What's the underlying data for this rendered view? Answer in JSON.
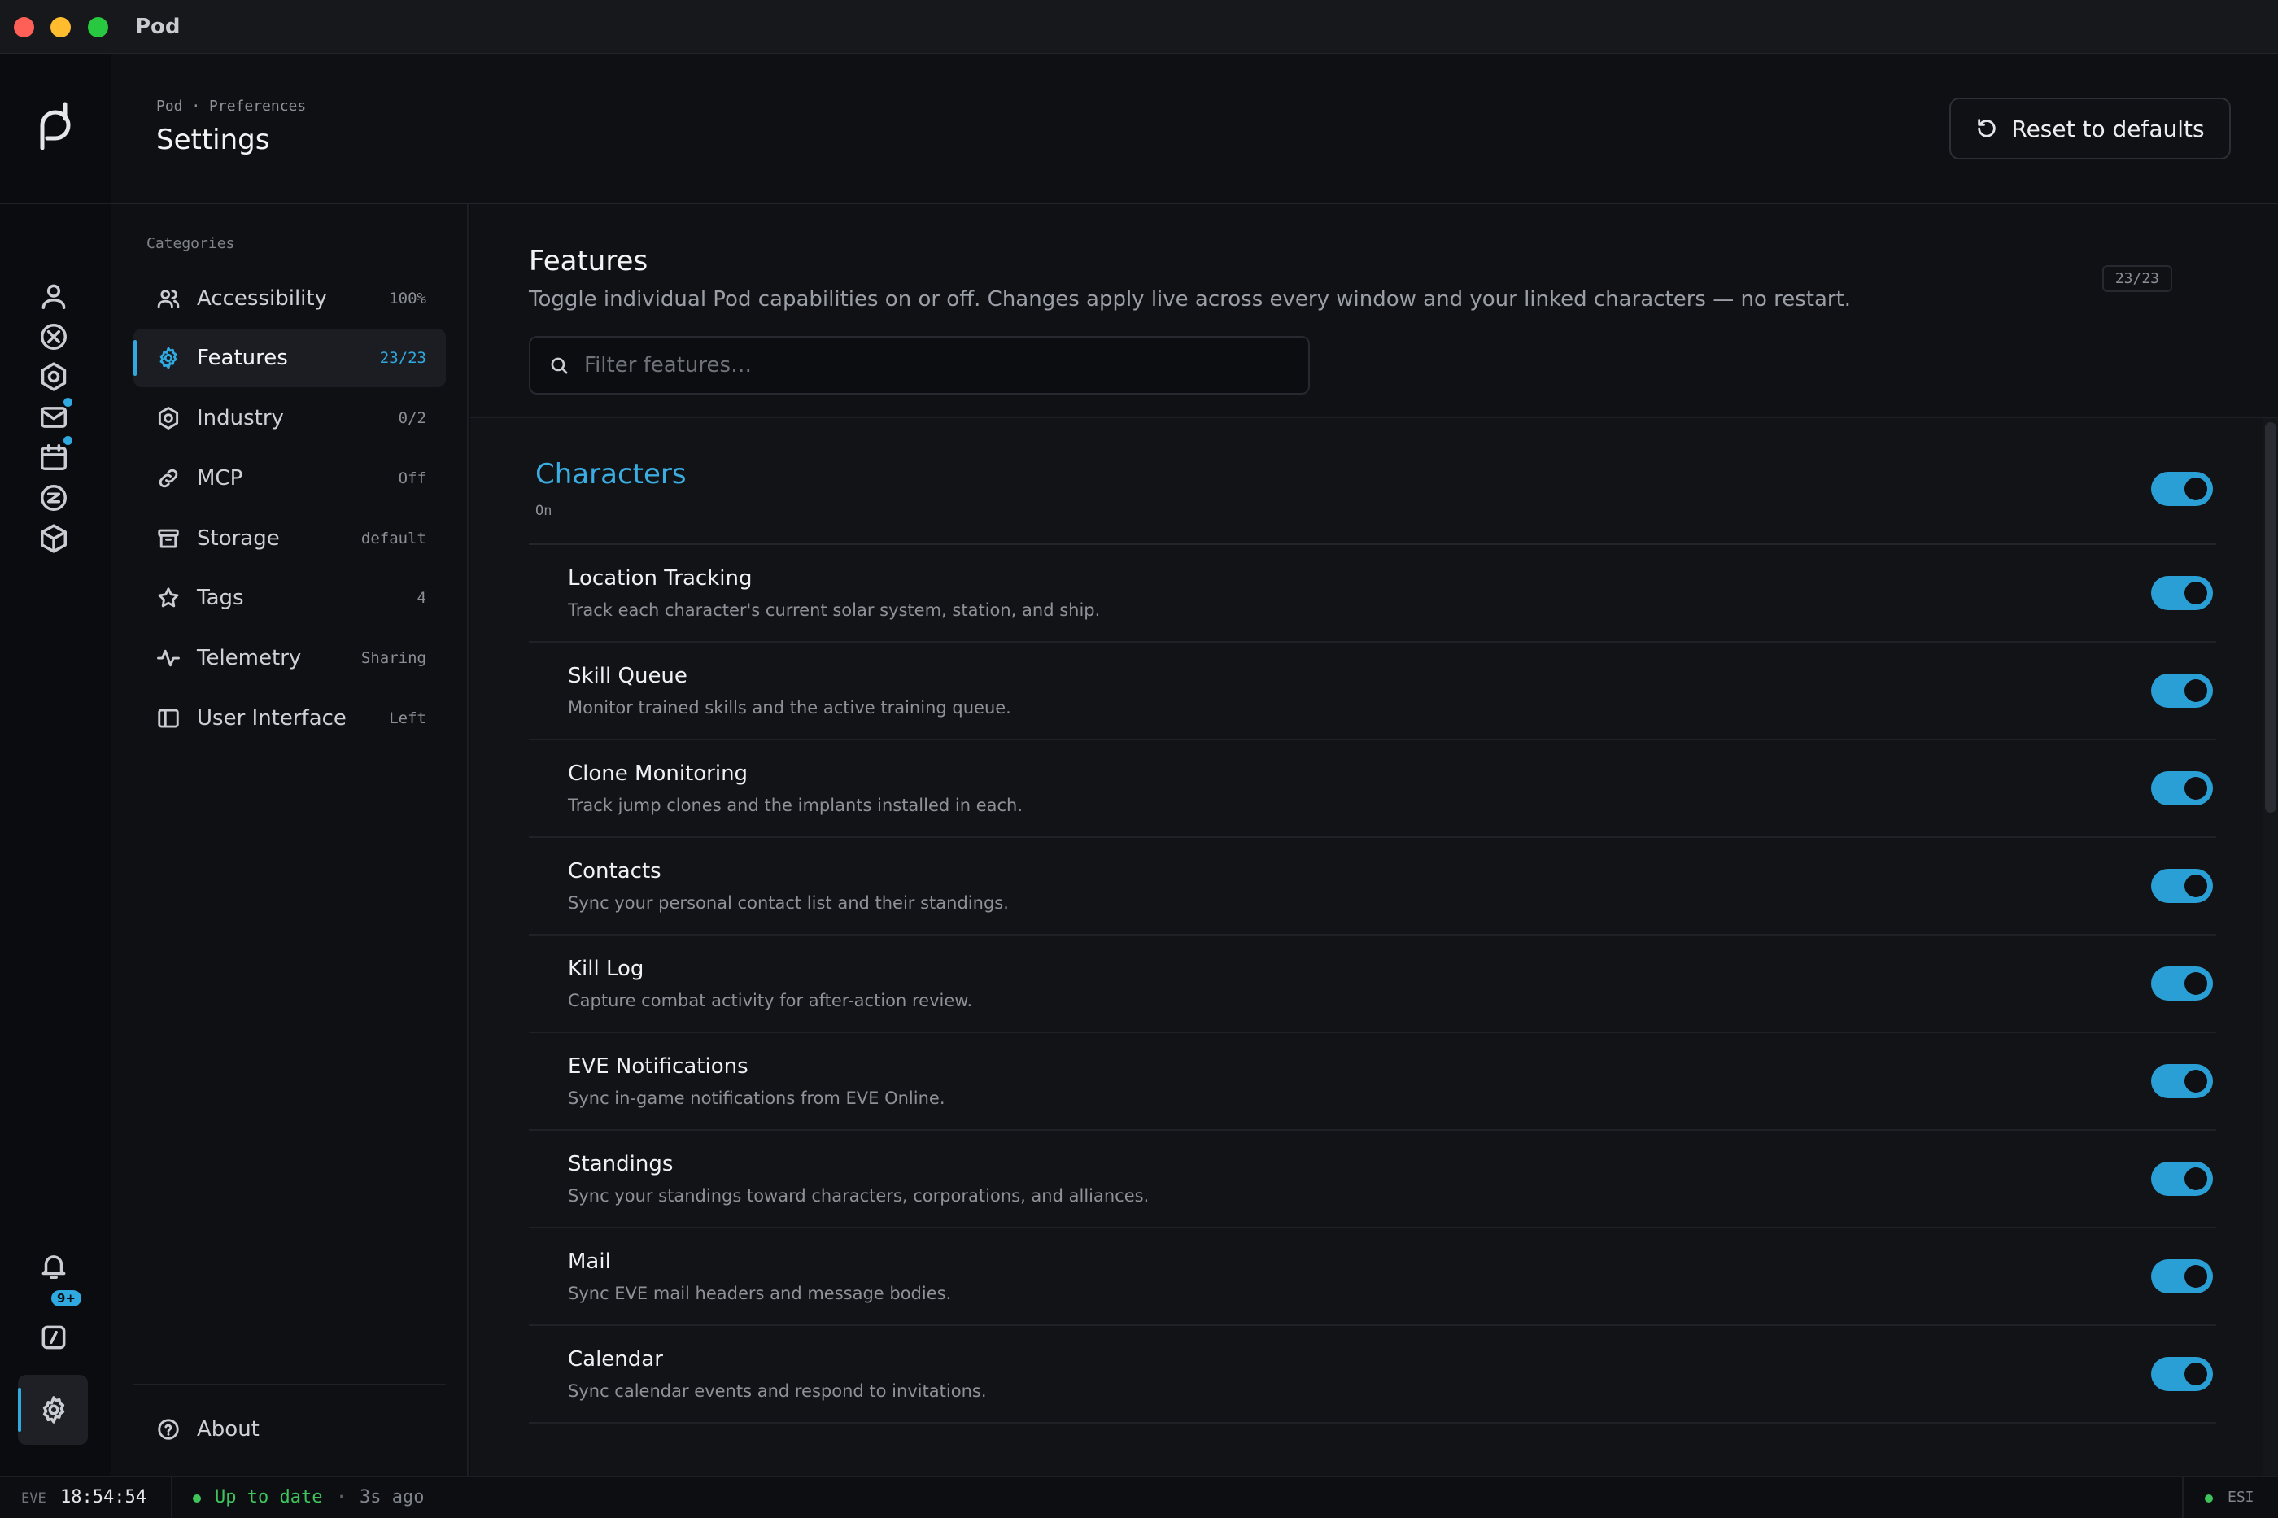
{
  "window": {
    "title": "Pod"
  },
  "header": {
    "breadcrumb": "Pod · Preferences",
    "title": "Settings",
    "reset_label": "Reset to defaults"
  },
  "categories": {
    "heading": "Categories",
    "items": [
      {
        "label": "Accessibility",
        "value": "100%",
        "icon": "users-icon"
      },
      {
        "label": "Features",
        "value": "23/23",
        "icon": "gear-icon",
        "active": true
      },
      {
        "label": "Industry",
        "value": "0/2",
        "icon": "hexagon-icon"
      },
      {
        "label": "MCP",
        "value": "Off",
        "icon": "link-icon"
      },
      {
        "label": "Storage",
        "value": "default",
        "icon": "archive-icon"
      },
      {
        "label": "Tags",
        "value": "4",
        "icon": "star-icon"
      },
      {
        "label": "Telemetry",
        "value": "Sharing",
        "icon": "activity-icon"
      },
      {
        "label": "User Interface",
        "value": "Left",
        "icon": "sidebar-icon"
      }
    ],
    "about_label": "About"
  },
  "rail": {
    "notification_badge": "9+",
    "icons": [
      "user-icon",
      "circle-x-icon",
      "hexagon-icon",
      "mail-icon",
      "calendar-icon",
      "circle-z-icon",
      "cube-icon",
      "bell-icon",
      "slash-square-icon",
      "gear-icon"
    ]
  },
  "features_section": {
    "title": "Features",
    "description": "Toggle individual Pod capabilities on or off. Changes apply live across every window and your linked characters — no restart.",
    "count": "23/23",
    "filter_placeholder": "Filter features…",
    "group": {
      "title": "Characters",
      "state": "On",
      "enabled": true
    },
    "items": [
      {
        "name": "Location Tracking",
        "description": "Track each character's current solar system, station, and ship.",
        "enabled": true
      },
      {
        "name": "Skill Queue",
        "description": "Monitor trained skills and the active training queue.",
        "enabled": true
      },
      {
        "name": "Clone Monitoring",
        "description": "Track jump clones and the implants installed in each.",
        "enabled": true
      },
      {
        "name": "Contacts",
        "description": "Sync your personal contact list and their standings.",
        "enabled": true
      },
      {
        "name": "Kill Log",
        "description": "Capture combat activity for after-action review.",
        "enabled": true
      },
      {
        "name": "EVE Notifications",
        "description": "Sync in-game notifications from EVE Online.",
        "enabled": true
      },
      {
        "name": "Standings",
        "description": "Sync your standings toward characters, corporations, and alliances.",
        "enabled": true
      },
      {
        "name": "Mail",
        "description": "Sync EVE mail headers and message bodies.",
        "enabled": true
      },
      {
        "name": "Calendar",
        "description": "Sync calendar events and respond to invitations.",
        "enabled": true
      }
    ]
  },
  "statusbar": {
    "eve_label": "EVE",
    "clock": "18:54:54",
    "sync_status": "Up to date",
    "separator": "·",
    "sync_ago": "3s ago",
    "esi_label": "ESI"
  },
  "colors": {
    "accent": "#2fa9e0",
    "ok": "#3ec45b",
    "background": "#0b0c0f"
  }
}
